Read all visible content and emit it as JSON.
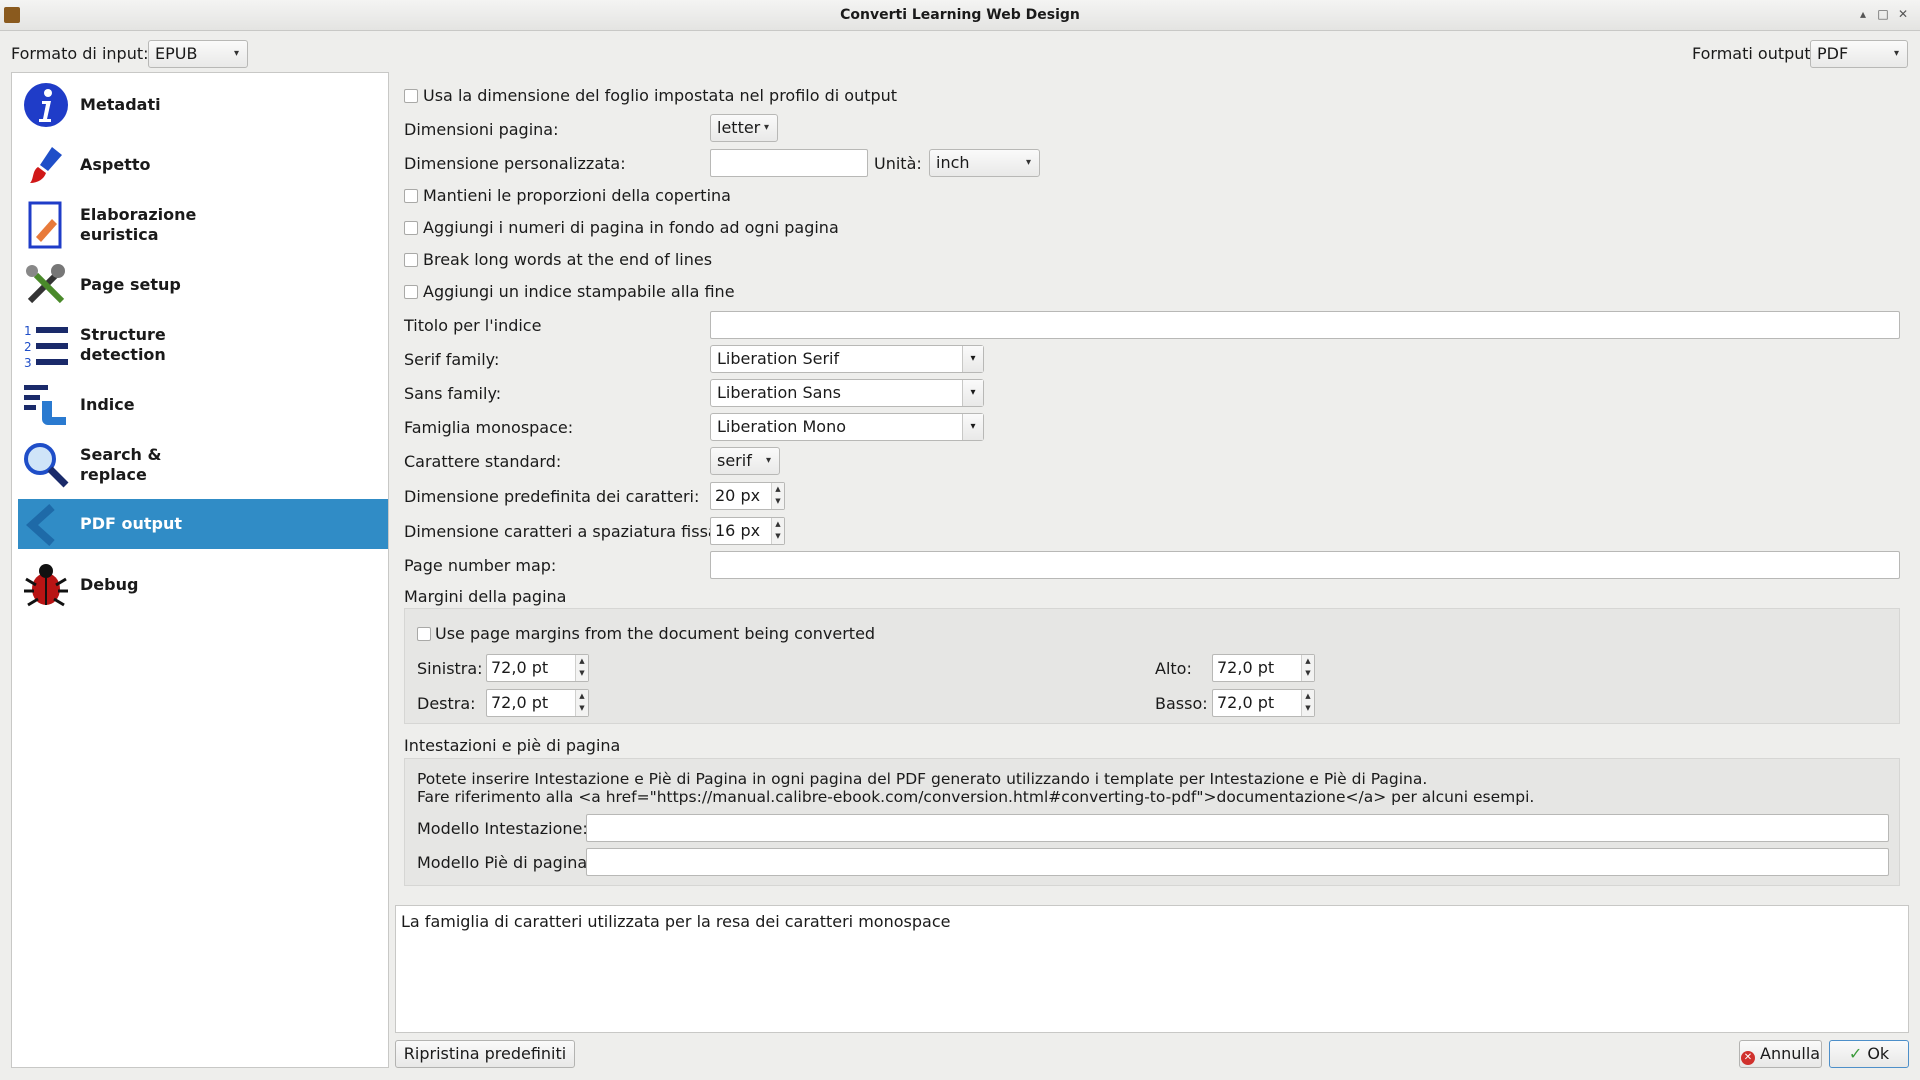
{
  "window": {
    "title": "Converti Learning Web Design"
  },
  "top": {
    "input_format_label": "Formato di input:",
    "input_format_value": "EPUB",
    "output_format_label": "Formati output",
    "output_format_value": "PDF"
  },
  "sidebar": {
    "items": [
      {
        "label": "Metadati",
        "icon": "info-icon"
      },
      {
        "label": "Aspetto",
        "icon": "brush-icon"
      },
      {
        "label": "Elaborazione\neuristica",
        "icon": "heuristics-icon"
      },
      {
        "label": "Page setup",
        "icon": "tools-icon"
      },
      {
        "label": "Structure\ndetection",
        "icon": "numbered-list-icon"
      },
      {
        "label": "Indice",
        "icon": "toc-icon"
      },
      {
        "label": "Search &\nreplace",
        "icon": "magnifier-icon"
      },
      {
        "label": "PDF output",
        "icon": "back-arrow-icon"
      },
      {
        "label": "Debug",
        "icon": "bug-icon"
      }
    ],
    "active_index": 7
  },
  "form": {
    "use_profile_size": "Usa la dimensione del foglio impostata nel profilo di output",
    "page_size_label": "Dimensioni pagina:",
    "page_size_value": "letter",
    "custom_size_label": "Dimensione personalizzata:",
    "custom_size_value": "",
    "unit_label": "Unità:",
    "unit_value": "inch",
    "keep_cover_ratio": "Mantieni le proporzioni della copertina",
    "add_page_numbers": "Aggiungi i numeri di pagina in fondo ad ogni pagina",
    "break_long_words": "Break long words at the end of lines",
    "add_printable_toc": "Aggiungi un indice stampabile alla fine",
    "toc_title_label": "Titolo per l'indice",
    "toc_title_value": "",
    "serif_label": "Serif family:",
    "serif_value": "Liberation Serif",
    "sans_label": "Sans family:",
    "sans_value": "Liberation Sans",
    "mono_label": "Famiglia monospace:",
    "mono_value": "Liberation Mono",
    "std_font_label": "Carattere standard:",
    "std_font_value": "serif",
    "default_size_label": "Dimensione predefinita dei caratteri:",
    "default_size_value": "20 px",
    "mono_size_label": "Dimensione caratteri a spaziatura fissa:",
    "mono_size_value": "16 px",
    "page_map_label": "Page number map:",
    "page_map_value": ""
  },
  "margins": {
    "group_title": "Margini della pagina",
    "use_doc_margins": "Use page margins from the document being converted",
    "left_label": "Sinistra:",
    "left_value": "72,0 pt",
    "right_label": "Destra:",
    "right_value": "72,0 pt",
    "top_label": "Alto:",
    "top_value": "72,0 pt",
    "bottom_label": "Basso:",
    "bottom_value": "72,0 pt"
  },
  "headers": {
    "group_title": "Intestazioni e piè di pagina",
    "info_line1": "Potete inserire Intestazione e Piè di Pagina in ogni pagina del PDF generato utilizzando i template per Intestazione e Piè di Pagina.",
    "info_line2": "Fare riferimento alla <a href=\"https://manual.calibre-ebook.com/conversion.html#converting-to-pdf\">documentazione</a> per alcuni esempi.",
    "header_label": "Modello Intestazione:",
    "header_value": "",
    "footer_label": "Modello Piè di pagina",
    "footer_value": ""
  },
  "help_text": "La famiglia di caratteri utilizzata per la resa dei caratteri monospace",
  "buttons": {
    "restore": "Ripristina predefiniti",
    "cancel": "Annulla",
    "ok": "Ok"
  },
  "colors": {
    "accent": "#308cc6",
    "cancel_red": "#d0312d",
    "ok_green": "#3a9a3a"
  }
}
